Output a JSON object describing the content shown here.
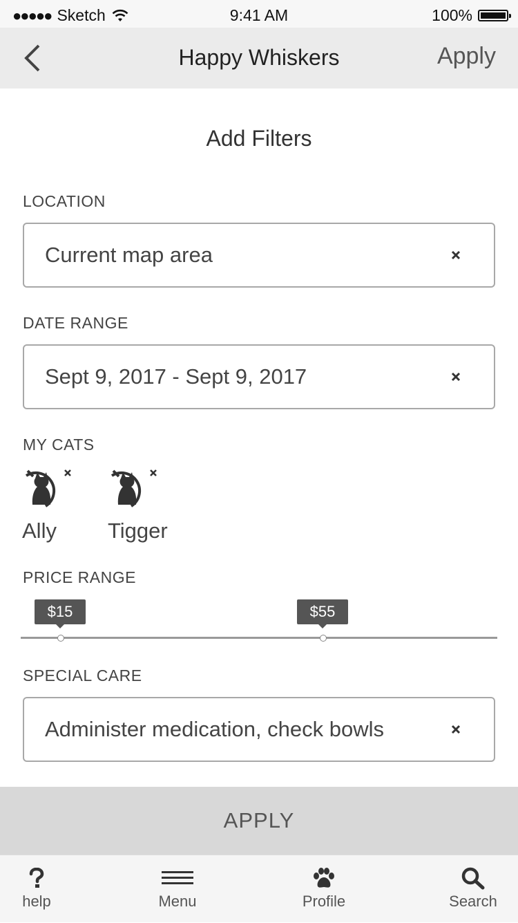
{
  "status_bar": {
    "carrier": "Sketch",
    "time": "9:41 AM",
    "battery": "100%"
  },
  "nav": {
    "title": "Happy Whiskers",
    "apply_label": "Apply",
    "back_icon": "chevron-left-icon"
  },
  "page_title": "Add Filters",
  "location": {
    "label": "LOCATION",
    "value": "Current map area"
  },
  "date_range": {
    "label": "DATE RANGE",
    "value": "Sept 9, 2017 - Sept 9, 2017"
  },
  "my_cats": {
    "label": "MY CATS",
    "cats": [
      {
        "name": "Ally",
        "icon": "cat-icon"
      },
      {
        "name": "Tigger",
        "icon": "cat-icon"
      }
    ]
  },
  "price_range": {
    "label": "PRICE RANGE",
    "min_label": "$15",
    "max_label": "$55"
  },
  "special_care": {
    "label": "SPECIAL CARE",
    "value": "Administer medication, check bowls"
  },
  "apply_button_label": "APPLY",
  "tabs": [
    {
      "label": "help",
      "icon": "question-icon"
    },
    {
      "label": "Menu",
      "icon": "menu-icon"
    },
    {
      "label": "Profile",
      "icon": "paw-icon"
    },
    {
      "label": "Search",
      "icon": "search-icon"
    }
  ]
}
